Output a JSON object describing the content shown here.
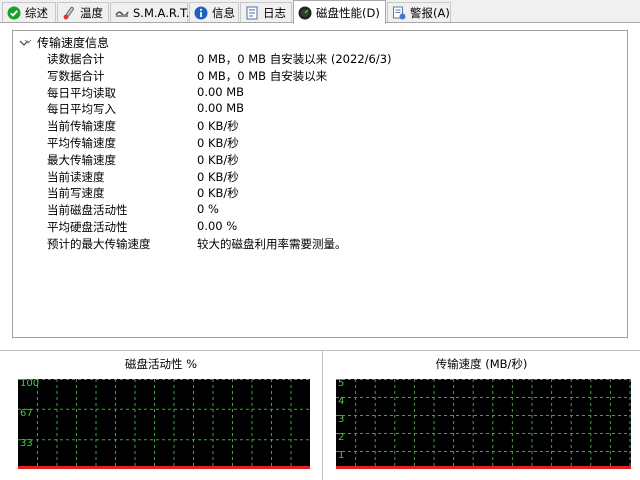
{
  "tabs": [
    {
      "label": "综述",
      "icon": "green-check-icon"
    },
    {
      "label": "温度",
      "icon": "thermometer-icon"
    },
    {
      "label": "S.M.A.R.T.",
      "icon": "smart-icon"
    },
    {
      "label": "信息",
      "icon": "info-icon"
    },
    {
      "label": "日志",
      "icon": "log-icon"
    },
    {
      "label": "磁盘性能(D)",
      "icon": "performance-gauge-icon",
      "active": true
    },
    {
      "label": "警报(A)",
      "icon": "alert-document-icon"
    }
  ],
  "info": {
    "group_title": "传输速度信息",
    "rows": [
      {
        "label": "读数据合计",
        "value": "0 MB，0 MB 自安装以来  (2022/6/3)"
      },
      {
        "label": "写数据合计",
        "value": "0 MB，0 MB 自安装以来"
      },
      {
        "label": "每日平均读取",
        "value": "0.00 MB"
      },
      {
        "label": "每日平均写入",
        "value": "0.00 MB"
      },
      {
        "label": "当前传输速度",
        "value": "0 KB/秒"
      },
      {
        "label": "平均传输速度",
        "value": "0 KB/秒"
      },
      {
        "label": "最大传输速度",
        "value": "0 KB/秒"
      },
      {
        "label": "当前读速度",
        "value": "0 KB/秒"
      },
      {
        "label": "当前写速度",
        "value": "0 KB/秒"
      },
      {
        "label": "当前磁盘活动性",
        "value": "0 %"
      },
      {
        "label": "平均硬盘活动性",
        "value": "0.00 %"
      },
      {
        "label": "预计的最大传输速度",
        "value": "较大的磁盘利用率需要测量。"
      }
    ]
  },
  "graphs": {
    "activity": {
      "title": "磁盘活动性 %",
      "ticks": [
        {
          "label": "100",
          "value": 100
        },
        {
          "label": "67",
          "value": 67
        },
        {
          "label": "33",
          "value": 33
        }
      ],
      "ymax": 100,
      "current": 0
    },
    "transfer": {
      "title": "传输速度  (MB/秒)",
      "ticks": [
        {
          "label": "5",
          "value": 5
        },
        {
          "label": "4",
          "value": 4
        },
        {
          "label": "3",
          "value": 3
        },
        {
          "label": "2",
          "value": 2
        },
        {
          "label": "1",
          "value": 1
        }
      ],
      "ymax": 5,
      "current": 0
    }
  },
  "colors": {
    "grid": "#2fae2f",
    "tick_text": "#39d339",
    "baseline": "#e02020",
    "graph_bg": "#000000"
  }
}
